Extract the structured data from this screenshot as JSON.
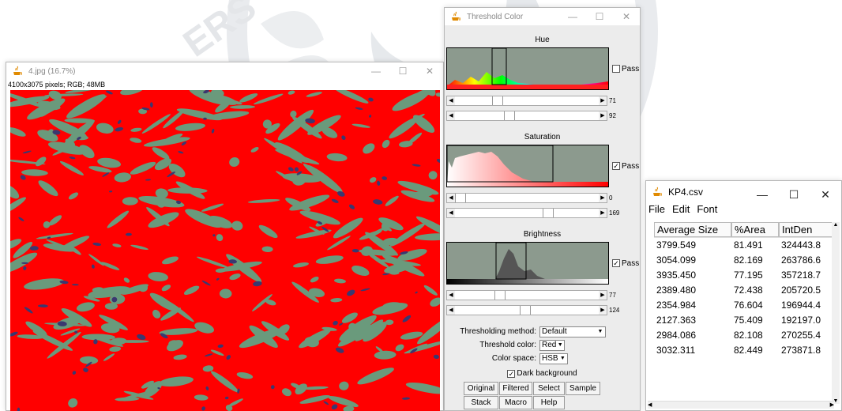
{
  "image_window": {
    "title": "4.jpg (16.7%)",
    "info": "4100x3075 pixels; RGB; 48MB"
  },
  "threshold_window": {
    "title": "Threshold Color",
    "hue": {
      "label": "Hue",
      "pass_label": "Pass",
      "pass_checked": false,
      "min_value": "71",
      "max_value": "92",
      "min_fraction": 0.28,
      "max_fraction": 0.37
    },
    "saturation": {
      "label": "Saturation",
      "pass_label": "Pass",
      "pass_checked": true,
      "min_value": "0",
      "max_value": "169",
      "min_fraction": 0.0,
      "max_fraction": 0.66
    },
    "brightness": {
      "label": "Brightness",
      "pass_label": "Pass",
      "pass_checked": true,
      "min_value": "77",
      "max_value": "124",
      "min_fraction": 0.3,
      "max_fraction": 0.49
    },
    "thresholding_method_label": "Thresholding method:",
    "thresholding_method_value": "Default",
    "threshold_color_label": "Threshold color:",
    "threshold_color_value": "Red",
    "color_space_label": "Color space:",
    "color_space_value": "HSB",
    "dark_background_label": "Dark background",
    "dark_background_checked": true,
    "buttons": {
      "original": "Original",
      "filtered": "Filtered",
      "select": "Select",
      "sample": "Sample",
      "stack": "Stack",
      "macro": "Macro",
      "help": "Help"
    }
  },
  "csv_window": {
    "title": "KP4.csv",
    "menu": {
      "file": "File",
      "edit": "Edit",
      "font": "Font"
    },
    "columns": [
      "Average Size",
      "%Area",
      "IntDen"
    ],
    "rows": [
      [
        "3799.549",
        "81.491",
        "324443.8"
      ],
      [
        "3054.099",
        "82.169",
        "263786.6"
      ],
      [
        "3935.450",
        "77.195",
        "357218.7"
      ],
      [
        "2389.480",
        "72.438",
        "205720.5"
      ],
      [
        "2354.984",
        "76.604",
        "196944.4"
      ],
      [
        "2127.363",
        "75.409",
        "192197.0"
      ],
      [
        "2984.086",
        "82.108",
        "270255.4"
      ],
      [
        "3032.311",
        "82.449",
        "273871.8"
      ]
    ]
  },
  "watermark": {
    "text": "ERS"
  },
  "colors": {
    "threshold_red": "#ff0000",
    "tissue_green": "#6a9a7c",
    "nuclei_blue": "#3a3870"
  }
}
